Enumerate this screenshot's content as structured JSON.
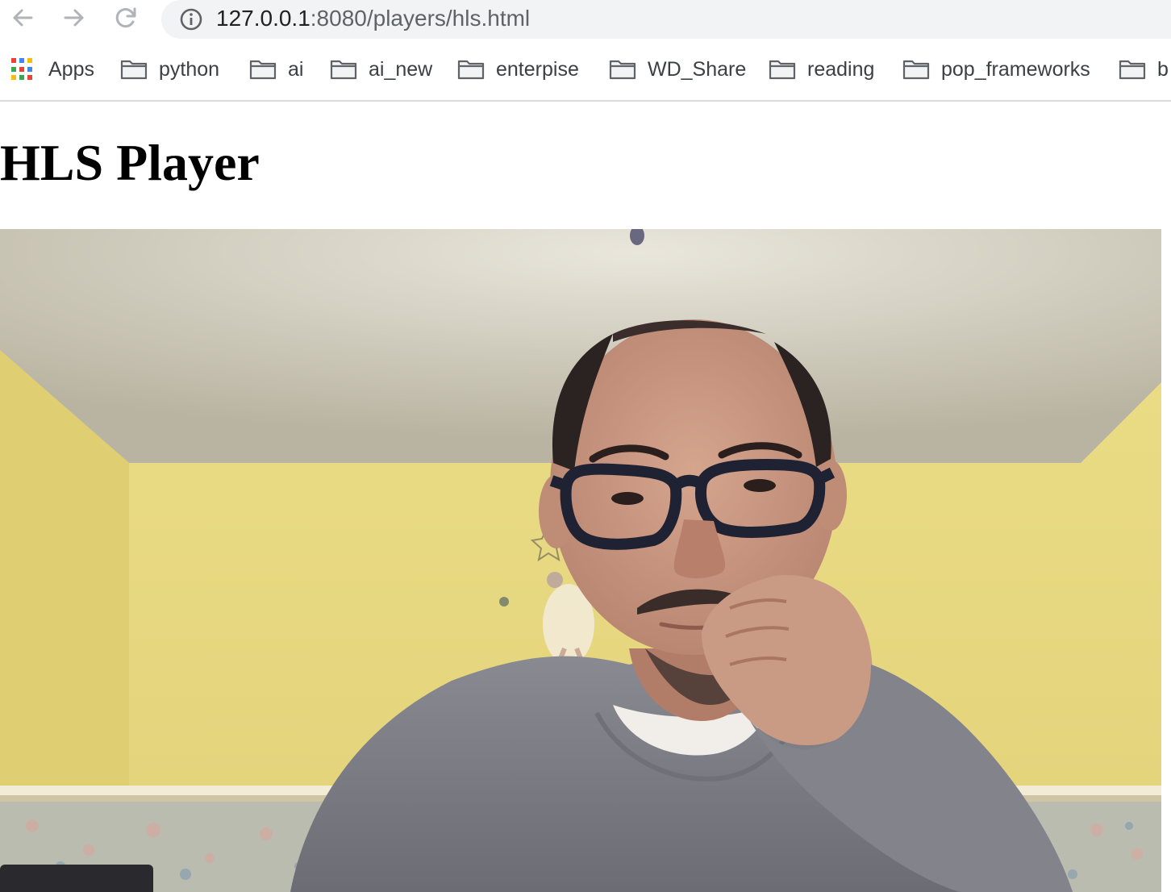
{
  "browser": {
    "url_host": "127.0.0.1",
    "url_path": ":8080/players/hls.html"
  },
  "bookmarks": [
    {
      "label": "Apps",
      "icon": "apps-grid-icon"
    },
    {
      "label": "python",
      "icon": "folder-icon"
    },
    {
      "label": "ai",
      "icon": "folder-icon"
    },
    {
      "label": "ai_new",
      "icon": "folder-icon"
    },
    {
      "label": "enterpise",
      "icon": "folder-icon"
    },
    {
      "label": "WD_Share",
      "icon": "folder-icon"
    },
    {
      "label": "reading",
      "icon": "folder-icon"
    },
    {
      "label": "pop_frameworks",
      "icon": "folder-icon"
    },
    {
      "label": "b",
      "icon": "folder-icon"
    }
  ],
  "page": {
    "heading": "HLS Player"
  },
  "colors": {
    "wall": "#e6d97c",
    "ceiling": "#cfcab8",
    "sweater": "#7a7a82",
    "skin": "#c7967f"
  }
}
